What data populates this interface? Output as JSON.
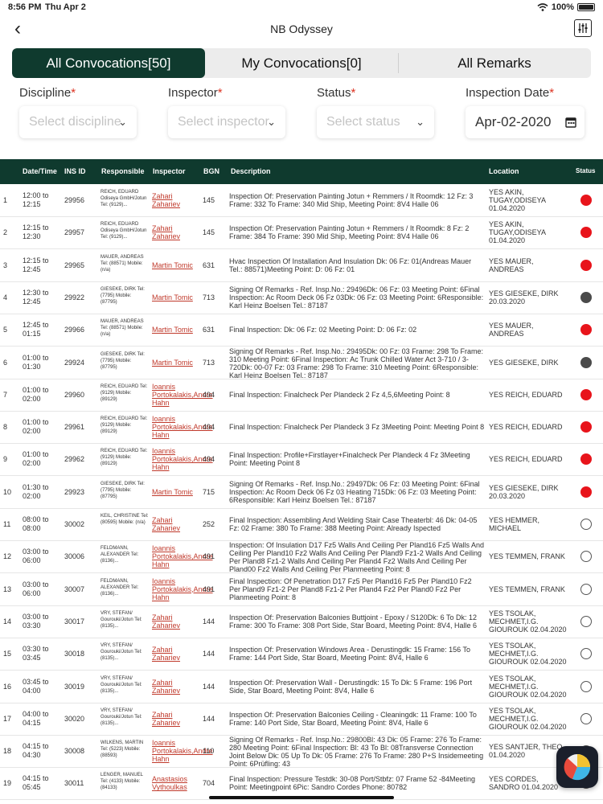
{
  "status_bar": {
    "time": "8:56 PM",
    "date": "Thu Apr 2",
    "battery": "100%"
  },
  "nav": {
    "title": "NB Odyssey"
  },
  "tabs": [
    {
      "label": "All Convocations[50]",
      "active": true
    },
    {
      "label": "My Convocations[0]",
      "active": false
    },
    {
      "label": "All Remarks",
      "active": false
    }
  ],
  "filters": {
    "discipline": {
      "label": "Discipline",
      "placeholder": "Select discipline"
    },
    "inspector": {
      "label": "Inspector",
      "placeholder": "Select inspector"
    },
    "status": {
      "label": "Status",
      "placeholder": "Select status"
    },
    "date": {
      "label": "Inspection Date",
      "value": "Apr-02-2020"
    },
    "required_mark": "*"
  },
  "table": {
    "headers": {
      "datetime": "Date/Time",
      "ins_id": "INS ID",
      "responsible": "Responsible",
      "inspector": "Inspector",
      "bgn": "BGN",
      "description": "Description",
      "location": "Location",
      "status": "Status"
    },
    "rows": [
      {
        "idx": "1",
        "time": "12:00 to 12:15",
        "ins": "29956",
        "resp": "REICH, EDUARD Odiseya GmbH/Jotun Tel: (9129)...",
        "insp": "Zahari Zahariev",
        "bgn": "145",
        "desc": "Inspection Of:  Preservation Painting Jotun + Remmers / It Roomdk:  12 Fz: 3 Frame:  332 To Frame:  340 Mid Ship, Meeting Point:  8V4 Halle 06",
        "loc": "YES     AKIN, TUGAY,ODISEYA 01.04.2020",
        "status": "red"
      },
      {
        "idx": "2",
        "time": "12:15 to 12:30",
        "ins": "29957",
        "resp": "REICH, EDUARD Odiseya GmbH/Jotun Tel: (9129)...",
        "insp": "Zahari Zahariev",
        "bgn": "145",
        "desc": "Inspection Of:  Preservation Painting Jotun + Remmers / It Roomdk:  8 Fz:  2 Frame:  384 To Frame:  390 Mid Ship, Meeting Point:  8V4 Halle 06",
        "loc": "YES     AKIN, TUGAY,ODISEYA 01.04.2020",
        "status": "red"
      },
      {
        "idx": "3",
        "time": "12:15 to 12:45",
        "ins": "29965",
        "resp": "MAUER, ANDREAS Tel: (88571) Mobile: (n/a)",
        "insp": "Martin Tomic",
        "bgn": "631",
        "desc": "Hvac Inspection Of Installation And Insulation Dk:  06 Fz:  01(Andreas Mauer Tel.: 88571)Meeting Point:  D: 06 Fz: 01",
        "loc": "YES     MAUER, ANDREAS",
        "status": "red"
      },
      {
        "idx": "4",
        "time": "12:30 to 12:45",
        "ins": "29922",
        "resp": "GIESEKE, DIRK Tel: (7795) Mobile: (87795)",
        "insp": "Martin Tomic",
        "bgn": "713",
        "desc": "Signing Of Remarks - Ref. Insp.No.:  29496Dk:  06 Fz:  03 Meeting Point: 6Final Inspection:  Ac Room Deck 06 Fz 03Dk:  06 Fz:  03  Meeting Point: 6Responsible:  Karl Heinz Boelsen Tel.:  87187",
        "loc": "YES     GIESEKE, DIRK 20.03.2020",
        "status": "grey"
      },
      {
        "idx": "5",
        "time": "12:45 to 01:15",
        "ins": "29966",
        "resp": "MAUER, ANDREAS Tel: (88571) Mobile: (n/a)",
        "insp": "Martin Tomic",
        "bgn": "631",
        "desc": "Final Inspection: Dk:  06 Fz:  02 Meeting Point:  D: 06 Fz: 02",
        "loc": "YES     MAUER, ANDREAS",
        "status": "red"
      },
      {
        "idx": "6",
        "time": "01:00 to 01:30",
        "ins": "29924",
        "resp": "GIESEKE, DIRK Tel: (7795) Mobile: (87795)",
        "insp": "Martin Tomic",
        "bgn": "713",
        "desc": "Signing Of Remarks - Ref. Insp.No.:  29495Dk:  00 Fz:  03 Frame:  298 To Frame:  310 Meeting Point:  6Final Inspection:  Ac Trunk Chilled Water Act 3-710 / 3-720Dk:  00-07 Fz:  03 Frame:  298 To Frame:  310 Meeting Point: 6Responsible:  Karl Heinz Boelsen Tel.:  87187",
        "loc": "YES     GIESEKE, DIRK",
        "status": "grey"
      },
      {
        "idx": "7",
        "time": "01:00 to 02:00",
        "ins": "29960",
        "resp": "REICH, EDUARD Tel: (9129) Mobile: (89129)",
        "insp": "Ioannis Portokalakis,Andre Hahn",
        "bgn": "494",
        "desc": "Final Inspection:  Finalcheck Per Plandeck 2 Fz 4,5,6Meeting Point:  8",
        "loc": "YES     REICH, EDUARD",
        "status": "red"
      },
      {
        "idx": "8",
        "time": "01:00 to 02:00",
        "ins": "29961",
        "resp": "REICH, EDUARD Tel: (9129) Mobile: (89129)",
        "insp": "Ioannis Portokalakis,Andre Hahn",
        "bgn": "494",
        "desc": "Final Inspection:  Finalcheck Per Plandeck 3 Fz 3Meeting Point:  Meeting Point 8",
        "loc": "YES     REICH, EDUARD",
        "status": "red"
      },
      {
        "idx": "9",
        "time": "01:00 to 02:00",
        "ins": "29962",
        "resp": "REICH, EDUARD Tel: (9129) Mobile: (89129)",
        "insp": "Ioannis Portokalakis,Andre Hahn",
        "bgn": "494",
        "desc": "Final Inspection:  Profile+Firstlayer+Finalcheck Per Plandeck 4 Fz 3Meeting Point:  Meeting  Point 8",
        "loc": "YES     REICH, EDUARD",
        "status": "red"
      },
      {
        "idx": "10",
        "time": "01:30 to 02:00",
        "ins": "29923",
        "resp": "GIESEKE, DIRK Tel: (7795) Mobile: (87795)",
        "insp": "Martin Tomic",
        "bgn": "715",
        "desc": "Signing Of Remarks - Ref. Insp.No.:  29497Dk:  06 Fz:  03 Meeting Point: 6Final Inspection:  Ac Room Deck 06 Fz 03 Heating 715Dk:  06 Fz:  03 Meeting Point:  6Responsible:  Karl Heinz Boelsen Tel.:  87187",
        "loc": "YES     GIESEKE, DIRK 20.03.2020",
        "status": "red"
      },
      {
        "idx": "11",
        "time": "08:00 to 08:00",
        "ins": "30002",
        "resp": "KEIL, CHRISTINE Tel: (80595) Mobile: (n/a)",
        "insp": "Zahari Zahariev",
        "bgn": "252",
        "desc": "Final Inspection:  Assembling And Welding Stair Case Theaterbl:  46 Dk: 04-05 Fz:  02 Frame:  380 To Frame:  388 Meeting Point:  Already Ispected",
        "loc": "YES     HEMMER, MICHAEL",
        "status": "none"
      },
      {
        "idx": "12",
        "time": "03:00 to 06:00",
        "ins": "30006",
        "resp": "FELDMANN, ALEXANDER Tel: (8136)...",
        "insp": "Ioannis Portokalakis,Andre Hahn",
        "bgn": "491",
        "desc": "Inspection:  Of Insulation D17 Fz5 Walls And Ceiling Per Pland16 Fz5 Walls And Ceiling Per Pland10 Fz2 Walls And Ceiling Per Pland9 Fz1-2 Walls And Ceiling Per Pland8 Fz1-2 Walls And Ceiling Per Pland4 Fz2 Walls And Ceiling Per Pland00 Fz2 Walls And Ceiling Per Planmeeting Point:  8",
        "loc": "YES     TEMMEN, FRANK",
        "status": "none"
      },
      {
        "idx": "13",
        "time": "03:00 to 06:00",
        "ins": "30007",
        "resp": "FELDMANN, ALEXANDER Tel: (8136)...",
        "insp": "Ioannis Portokalakis,Andre Hahn",
        "bgn": "491",
        "desc": "Final Inspection:  Of Penetration D17 Fz5 Per Pland16 Fz5 Per Pland10 Fz2 Per Pland9 Fz1-2 Per Pland8 Fz1-2 Per Pland4 Fz2 Per Pland0 Fz2 Per Planmeeting Point:  8",
        "loc": "YES     TEMMEN, FRANK",
        "status": "none"
      },
      {
        "idx": "14",
        "time": "03:00 to 03:30",
        "ins": "30017",
        "resp": "VRY, STEFAN/ Gourouki/Jotun Tel: (8135)...",
        "insp": "Zahari Zahariev",
        "bgn": "144",
        "desc": "Inspection Of:  Preservation Balconies Buttjoint - Epoxy / S120Dk:  6 To Dk: 12 Frame:  300 To Frame:  308 Port Side, Star Board, Meeting Point:  8V4, Halle 6",
        "loc": "YES     TSOLAK, MECHMET,I.G. GIOUROUK 02.04.2020",
        "status": "none"
      },
      {
        "idx": "15",
        "time": "03:30 to 03:45",
        "ins": "30018",
        "resp": "VRY, STEFAN/ Gourouki/Jotun Tel: (8135)...",
        "insp": "Zahari Zahariev",
        "bgn": "144",
        "desc": "Inspection Of:  Preservation Windows Area - Derustingdk:  15 Frame:  156 To Frame:  144 Port Side, Star Board, Meeting Point:  8V4, Halle 6",
        "loc": "YES     TSOLAK, MECHMET,I.G. GIOUROUK 02.04.2020",
        "status": "none"
      },
      {
        "idx": "16",
        "time": "03:45 to 04:00",
        "ins": "30019",
        "resp": "VRY, STEFAN/ Gourouki/Jotun Tel: (8135)...",
        "insp": "Zahari Zahariev",
        "bgn": "144",
        "desc": "Inspection Of:  Preservation Wall - Derustingdk:  15 To Dk:  5 Frame:  196 Port Side, Star Board, Meeting Point:  8V4, Halle 6",
        "loc": "YES     TSOLAK, MECHMET,I.G. GIOUROUK 02.04.2020",
        "status": "none"
      },
      {
        "idx": "17",
        "time": "04:00 to 04:15",
        "ins": "30020",
        "resp": "VRY, STEFAN/ Gourouki/Jotun Tel: (8135)...",
        "insp": "Zahari Zahariev",
        "bgn": "144",
        "desc": "Inspection Of:  Preservation Balconies Ceiling - Cleaningdk:  11 Frame:  100 To Frame:  140 Port Side, Star Board, Meeting Point:  8V4, Halle 6",
        "loc": "YES     TSOLAK, MECHMET,I.G. GIOUROUK 02.04.2020",
        "status": "none"
      },
      {
        "idx": "18",
        "time": "04:15 to 04:30",
        "ins": "30008",
        "resp": "WILKENS, MARTIN Tel: (5223) Mobile: (88593)",
        "insp": "Ioannis Portokalakis,Andre Hahn",
        "bgn": "110",
        "desc": "Signing Of Remarks - Ref. Insp.No.:  29800Bl:  43 Dk:  05 Frame:  276 To Frame:  280 Meeting Point:  6Final Inspection:  Bl:  43 To Bl:  08Transverse Connection Joint Below Dk:  05 Up To Dk:  05 Frame:  276 To Frame:  280 P+S Insidemeeting Point:  6Prüfling:  43",
        "loc": "YES     SANTJER, THEO 01.04.2020",
        "status": "none"
      },
      {
        "idx": "19",
        "time": "04:15 to 05:45",
        "ins": "30011",
        "resp": "LENGER, MANUEL Tel: (4133) Mobile: (84133)",
        "insp": "Anastasios Vythoulkas",
        "bgn": "704",
        "desc": "Final Inspection:  Pressure Testdk:  30-08 Port/Stbfz:  07 Frame 52 -84Meeting Point:  Meetingpoint 6Pic:  Sandro Cordes Phone: 80782",
        "loc": "YES     CORDES, SANDRO 01.04.2020",
        "status": "none"
      }
    ]
  },
  "status_colors": {
    "red": "#e8141b",
    "grey": "#4a4a4a"
  },
  "brand_color": "#0f3a2e"
}
